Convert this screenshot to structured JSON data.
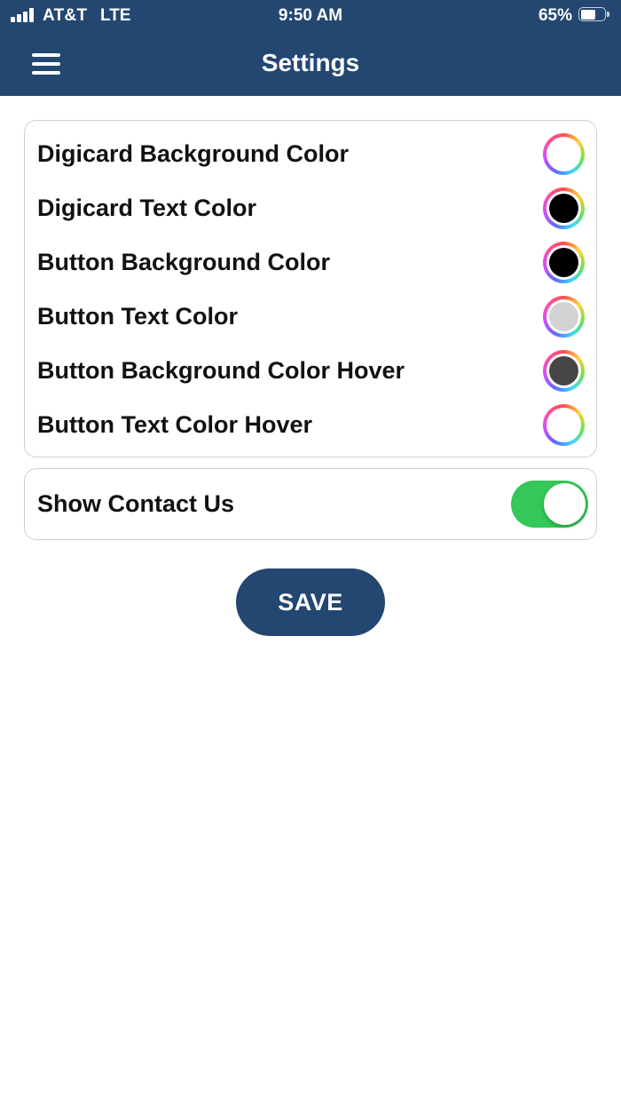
{
  "status_bar": {
    "carrier": "AT&T",
    "network": "LTE",
    "time": "9:50 AM",
    "battery_percent": "65%",
    "battery_level": 0.65,
    "signal_bars": 4
  },
  "nav": {
    "title": "Settings",
    "menu_icon": "hamburger-menu-icon"
  },
  "colors": {
    "header_bg": "#234771",
    "toggle_on": "#34c759",
    "swatch_ring": "rainbow"
  },
  "color_settings": [
    {
      "label": "Digicard Background Color",
      "color": "#ffffff"
    },
    {
      "label": "Digicard Text Color",
      "color": "#000000"
    },
    {
      "label": "Button Background Color",
      "color": "#000000"
    },
    {
      "label": "Button Text Color",
      "color": "#d3d3d3"
    },
    {
      "label": "Button Background Color Hover",
      "color": "#464646"
    },
    {
      "label": "Button Text Color Hover",
      "color": "#ffffff"
    }
  ],
  "contact_toggle": {
    "label": "Show Contact Us",
    "enabled": true
  },
  "save_label": "SAVE"
}
